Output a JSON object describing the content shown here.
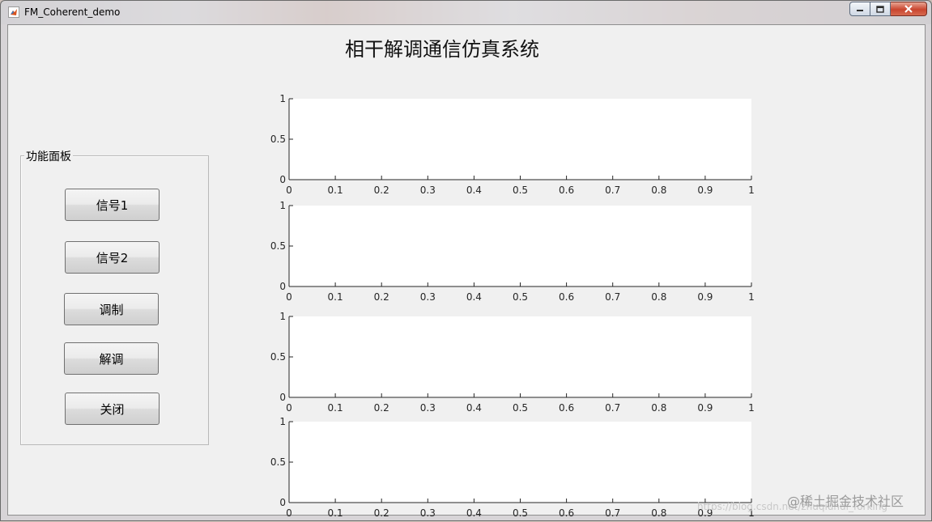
{
  "window": {
    "title": "FM_Coherent_demo"
  },
  "app": {
    "heading": "相干解调通信仿真系统"
  },
  "panel": {
    "label": "功能面板",
    "buttons": [
      {
        "id": "signal1",
        "label": "信号1"
      },
      {
        "id": "signal2",
        "label": "信号2"
      },
      {
        "id": "modulate",
        "label": "调制"
      },
      {
        "id": "demodulate",
        "label": "解调"
      },
      {
        "id": "close",
        "label": "关闭"
      }
    ]
  },
  "plots": {
    "count": 4,
    "x_ticks": [
      "0",
      "0.1",
      "0.2",
      "0.3",
      "0.4",
      "0.5",
      "0.6",
      "0.7",
      "0.8",
      "0.9",
      "1"
    ],
    "y_ticks": [
      "0",
      "0.5",
      "1"
    ],
    "xlim": [
      0,
      1
    ],
    "ylim": [
      0,
      1
    ]
  },
  "watermark": {
    "text": "@稀土掘金技术社区",
    "url": "https://blog.csdn.net/zhuqiuhui_forking"
  },
  "colors": {
    "client_bg": "#f0f0f0",
    "axes_bg": "#ffffff",
    "close_btn": "#c9452f"
  }
}
